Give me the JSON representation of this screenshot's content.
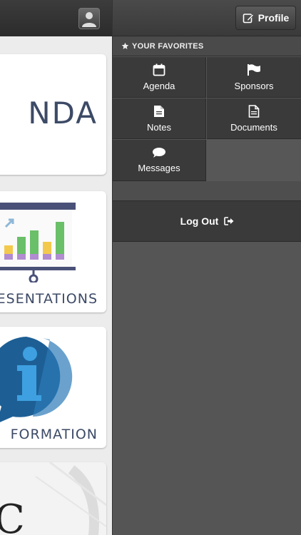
{
  "main": {
    "tiles": [
      {
        "label": "NDA"
      },
      {
        "label": "ESENTATIONS"
      },
      {
        "label": "FORMATION"
      },
      {
        "label": "C"
      }
    ]
  },
  "menu": {
    "profile_label": "Profile",
    "favorites_header": "YOUR FAVORITES",
    "favorites": [
      {
        "label": "Agenda",
        "icon": "calendar-icon"
      },
      {
        "label": "Sponsors",
        "icon": "flag-icon"
      },
      {
        "label": "Notes",
        "icon": "note-icon"
      },
      {
        "label": "Documents",
        "icon": "document-icon"
      },
      {
        "label": "Messages",
        "icon": "chat-bubble-icon"
      }
    ],
    "logout_label": "Log Out"
  },
  "colors": {
    "menu_bg": "#555555",
    "tile_bg": "#3a3a3a",
    "presentation_bars": [
      "#f2c94c",
      "#6abf69",
      "#6abf69",
      "#f2c94c",
      "#6abf69"
    ],
    "info_blue": "#1d6fa5"
  }
}
